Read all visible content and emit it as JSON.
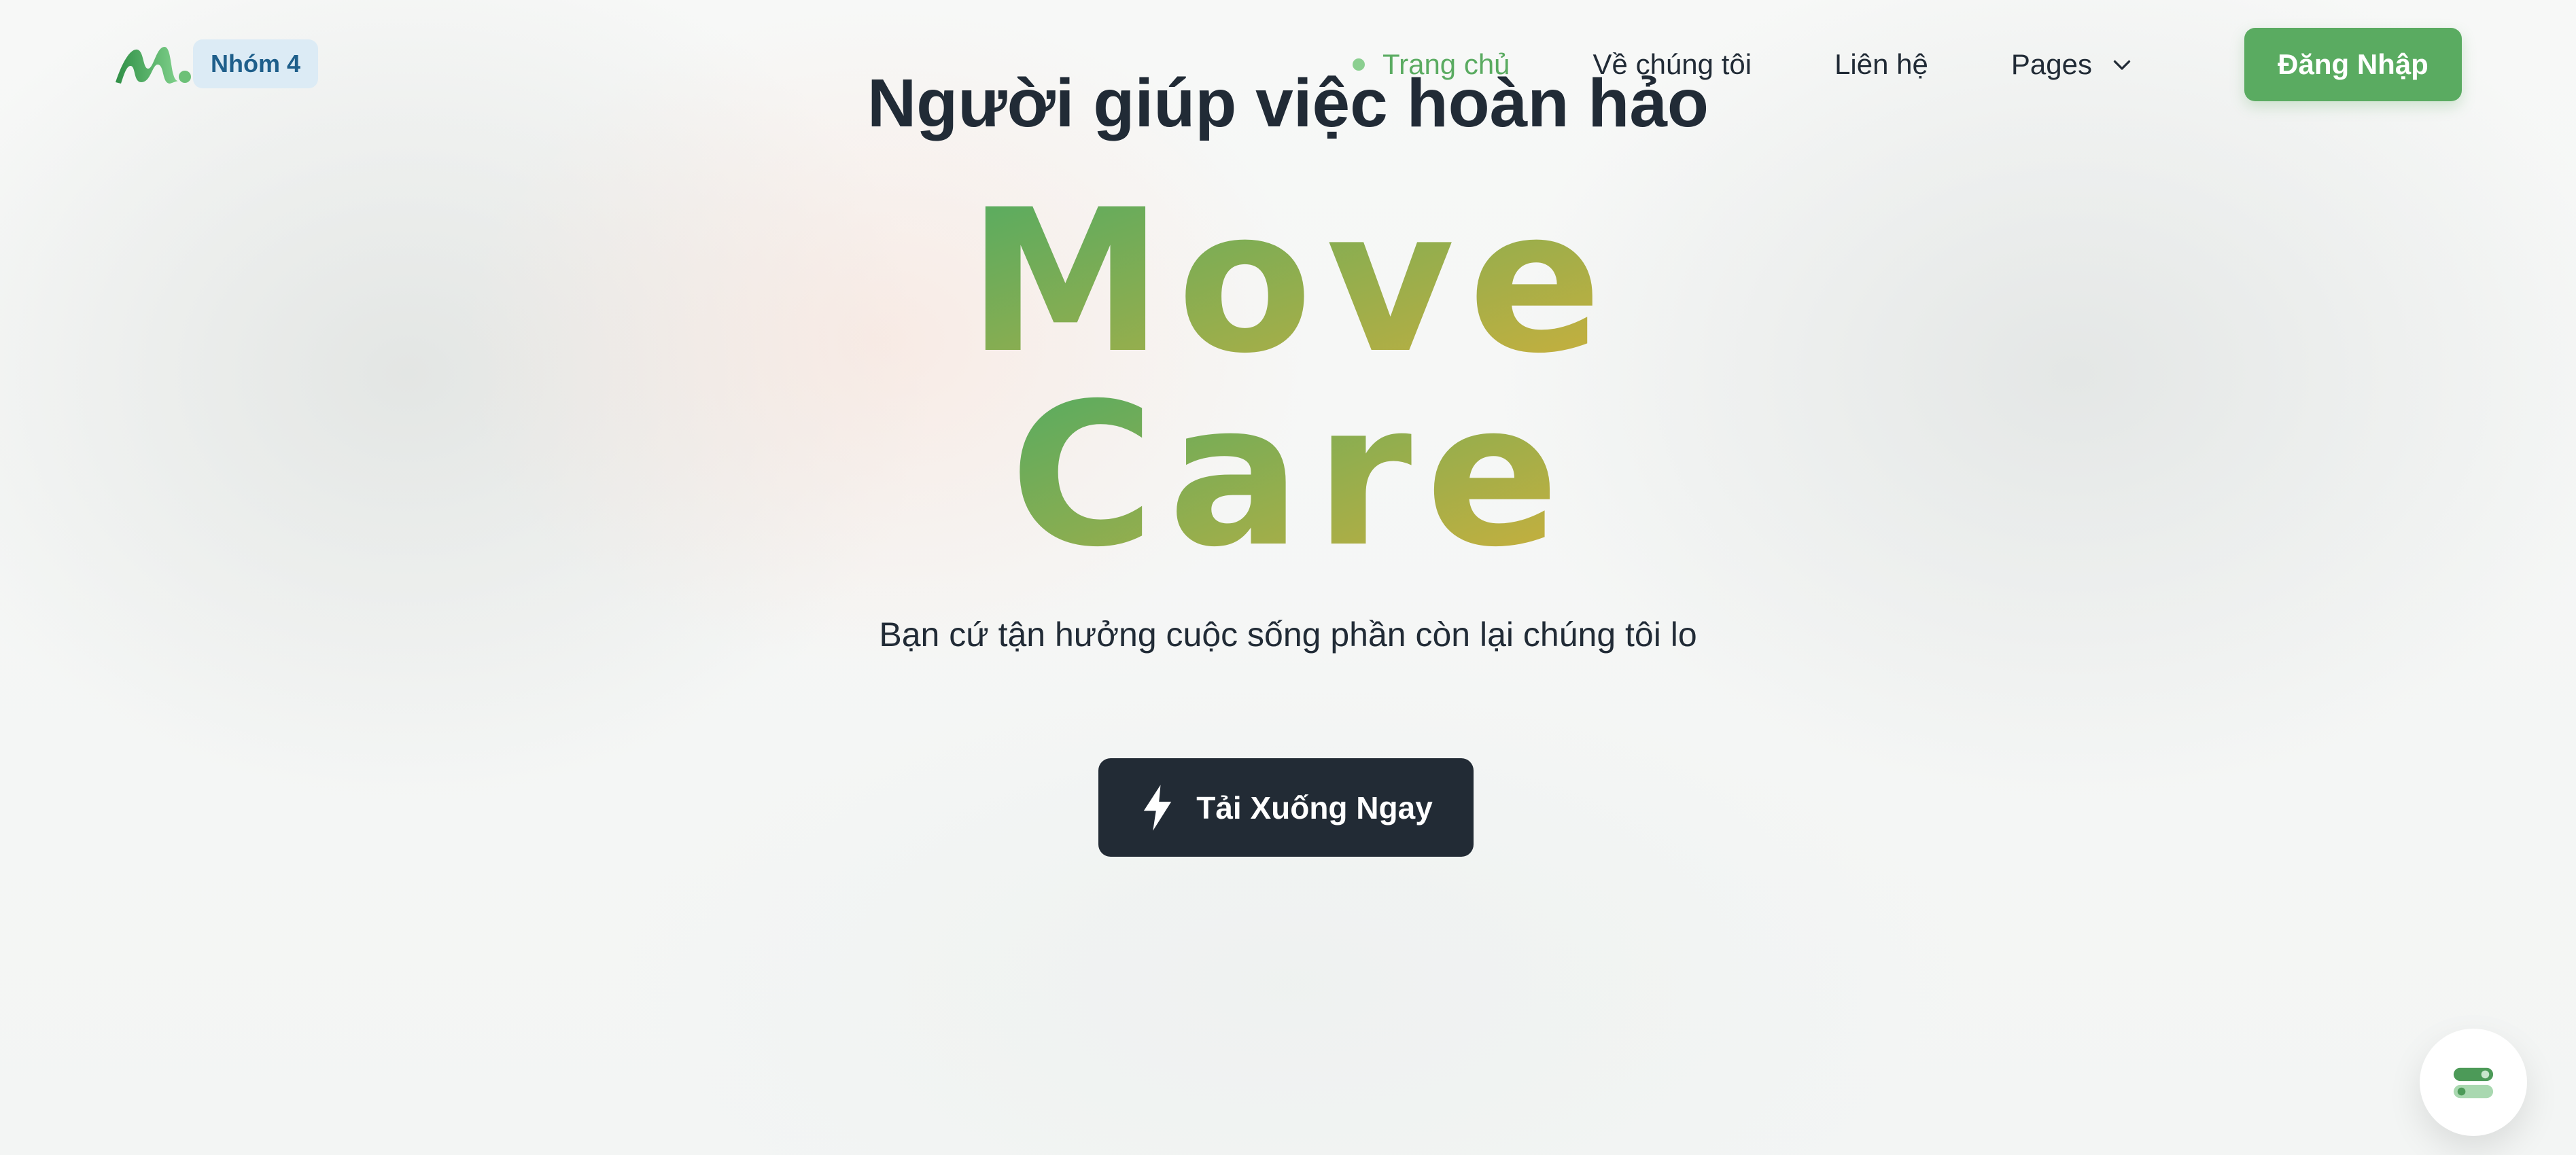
{
  "header": {
    "logo_badge": "Nhóm 4",
    "nav": [
      {
        "label": "Trang chủ",
        "active": true
      },
      {
        "label": "Về chúng tôi",
        "active": false
      },
      {
        "label": "Liên hệ",
        "active": false
      },
      {
        "label": "Pages",
        "active": false,
        "has_dropdown": true
      }
    ],
    "login_label": "Đăng Nhập"
  },
  "hero": {
    "headline": "Người giúp việc hoàn hảo",
    "brand_line1": "Move",
    "brand_line2": "Care",
    "tagline": "Bạn cứ tận hưởng cuộc sống phần còn lại chúng tôi lo",
    "cta_label": "Tải Xuống Ngay"
  },
  "icons": {
    "logo": "logo-mark-icon",
    "dropdown": "chevron-down-icon",
    "cta": "lightning-icon",
    "settings": "toggle-settings-icon"
  },
  "colors": {
    "accent_green": "#5aab61",
    "brand_gradient_start": "#4fab63",
    "brand_gradient_end": "#d2b03a",
    "dark": "#212b36",
    "badge_bg": "#dcebf5",
    "badge_text": "#1f5f8b"
  }
}
